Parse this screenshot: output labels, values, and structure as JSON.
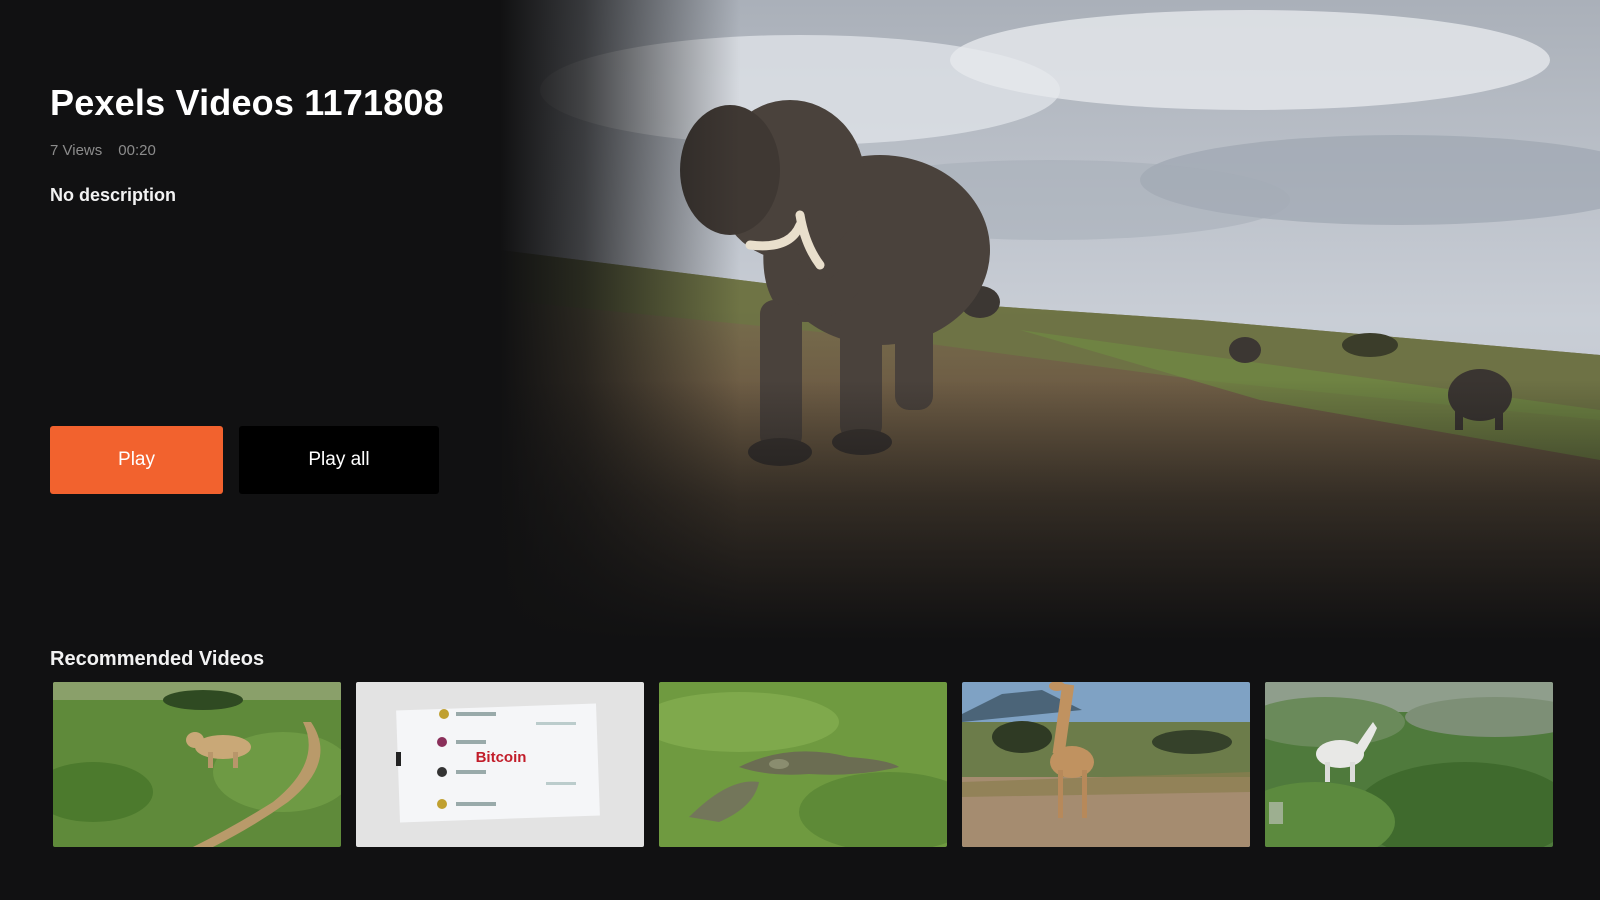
{
  "video": {
    "title": "Pexels Videos 1171808",
    "views": "7 Views",
    "duration": "00:20",
    "description": "No description"
  },
  "actions": {
    "play_label": "Play",
    "play_all_label": "Play all"
  },
  "recommended": {
    "heading": "Recommended Videos",
    "thumbnails": [
      {
        "icon": "lioness-thumbnail"
      },
      {
        "icon": "bitcoin-thumbnail",
        "overlay_text": "Bitcoin"
      },
      {
        "icon": "crocodile-thumbnail"
      },
      {
        "icon": "giraffe-thumbnail"
      },
      {
        "icon": "white-horse-thumbnail"
      }
    ]
  },
  "colors": {
    "background": "#111112",
    "accent": "#f2622e",
    "secondary_button": "#000000",
    "meta_text": "#8c8c8c"
  }
}
